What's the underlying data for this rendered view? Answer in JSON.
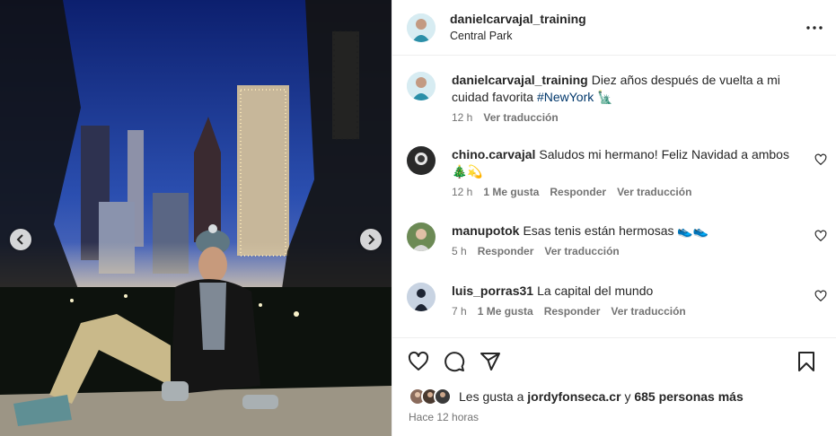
{
  "post": {
    "username": "danielcarvajal_training",
    "location": "Central Park",
    "caption_prefix": "Diez años después de vuelta a mi cuidad favorita ",
    "caption_hashtag": "#NewYork",
    "caption_emoji": "🗽",
    "caption_time": "12 h",
    "caption_translate": "Ver traducción"
  },
  "comments": [
    {
      "user": "chino.carvajal",
      "text": "Saludos mi hermano! Feliz Navidad a ambos 🎄💫",
      "time": "12 h",
      "likes": "1 Me gusta",
      "reply": "Responder",
      "translate": "Ver traducción"
    },
    {
      "user": "manupotok",
      "text": "Esas tenis están hermosas 👟👟",
      "time": "5 h",
      "likes": "",
      "reply": "Responder",
      "translate": "Ver traducción"
    },
    {
      "user": "luis_porras31",
      "text": "La capital del mundo",
      "time": "7 h",
      "likes": "1 Me gusta",
      "reply": "Responder",
      "translate": "Ver traducción"
    }
  ],
  "likes": {
    "prefix": "Les gusta a ",
    "user": "jordyfonseca.cr",
    "middle": " y ",
    "others": "685 personas más"
  },
  "posted_ago": "Hace 12 horas",
  "icons": [
    "more-options-icon",
    "heart-icon",
    "comment-icon",
    "share-icon",
    "bookmark-icon",
    "chevron-left-icon",
    "chevron-right-icon"
  ],
  "colors": {
    "hashtag": "#00376b",
    "meta": "#737373",
    "text": "#262626",
    "sky": "#1d3a8a"
  }
}
